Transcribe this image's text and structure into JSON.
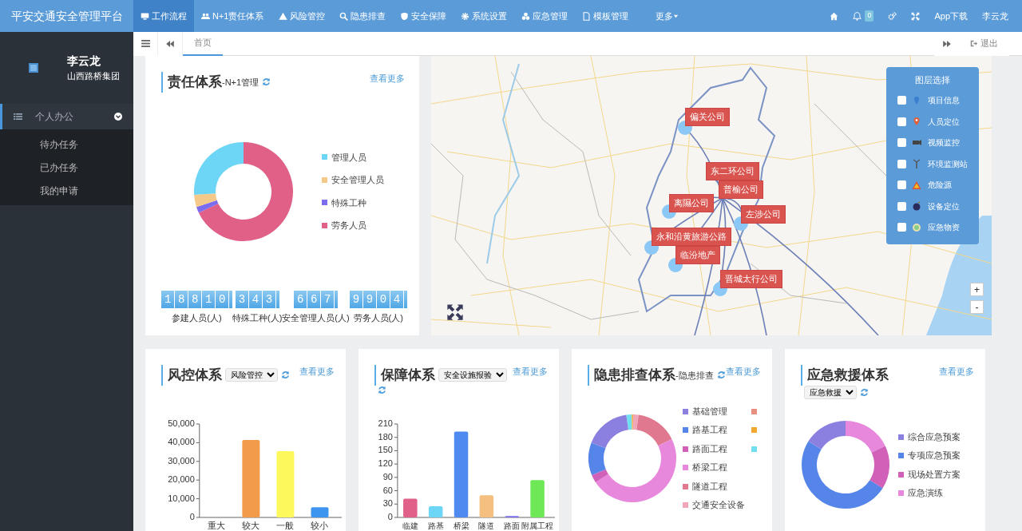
{
  "navbar": {
    "brand": "平安交通安全管理平台",
    "items": [
      {
        "label": "工作流程",
        "selected": true
      },
      {
        "label": "N+1责任体系",
        "selected": false
      },
      {
        "label": "风险管控",
        "selected": false
      },
      {
        "label": "隐患排查",
        "selected": false
      },
      {
        "label": "安全保障",
        "selected": false
      },
      {
        "label": "系统设置",
        "selected": false
      },
      {
        "label": "应急管理",
        "selected": false
      },
      {
        "label": "模板管理",
        "selected": false
      }
    ],
    "more": "更多",
    "notification_count": "0",
    "app_download": "App下载",
    "user": "李云龙"
  },
  "sidebar": {
    "user_name": "李云龙",
    "organization": "山西路桥集团",
    "menu": [
      {
        "label": "个人办公",
        "expanded": true,
        "children": [
          {
            "label": "待办任务"
          },
          {
            "label": "已办任务"
          },
          {
            "label": "我的申请"
          }
        ]
      }
    ]
  },
  "tabbar": {
    "tabs": [
      {
        "label": "首页",
        "selected": true
      }
    ],
    "logout": "退出"
  },
  "responsibility_panel": {
    "title": "责任体系",
    "subtitle": "-N+1管理",
    "more_link": "查看更多",
    "legend": [
      {
        "label": "管理人员",
        "color": "#6dd5f5"
      },
      {
        "label": "安全管理人员",
        "color": "#f5c98a"
      },
      {
        "label": "特殊工种",
        "color": "#7b6cf0"
      },
      {
        "label": "劳务人员",
        "color": "#e06087"
      }
    ],
    "counters": [
      {
        "value": "18810",
        "label": "参建人员(人)"
      },
      {
        "value": "343",
        "label": "特殊工种(人)"
      },
      {
        "value": "667",
        "label": "安全管理人员(人)"
      },
      {
        "value": "9904",
        "label": "劳务人员(人)"
      }
    ]
  },
  "map": {
    "markers": [
      {
        "label": "偏关公司"
      },
      {
        "label": "东二环公司"
      },
      {
        "label": "普榆公司"
      },
      {
        "label": "离隰公司"
      },
      {
        "label": "左涉公司"
      },
      {
        "label": "永和沿黄旅游公路"
      },
      {
        "label": "临汾地产"
      },
      {
        "label": "晋城太行公司"
      }
    ],
    "layer_panel": {
      "title": "图层选择",
      "layers": [
        {
          "label": "项目信息",
          "checked": false
        },
        {
          "label": "人员定位",
          "checked": false
        },
        {
          "label": "视频监控",
          "checked": false
        },
        {
          "label": "环境监测站",
          "checked": false
        },
        {
          "label": "危险源",
          "checked": false
        },
        {
          "label": "设备定位",
          "checked": false
        },
        {
          "label": "应急物资",
          "checked": false
        }
      ]
    },
    "zoom_in": "+",
    "zoom_out": "-"
  },
  "bottom_panels": [
    {
      "kind": "bar",
      "title": "风控体系",
      "select": "风险管控",
      "more_link": "查看更多",
      "chart_data": {
        "type": "bar",
        "categories": [
          "重大",
          "较大",
          "一般",
          "较小"
        ],
        "values": [
          0,
          41500,
          35500,
          5500
        ],
        "ylim": [
          0,
          50000
        ],
        "yticks": [
          {
            "value": 0,
            "label": "0"
          },
          {
            "value": 10000,
            "label": "10,000"
          },
          {
            "value": 20000,
            "label": "20,000"
          },
          {
            "value": 30000,
            "label": "30,000"
          },
          {
            "value": 40000,
            "label": "40,000"
          },
          {
            "value": 50000,
            "label": "50,000"
          }
        ]
      }
    },
    {
      "kind": "bar",
      "title": "保障体系",
      "select": "安全设施报验",
      "more_link": "查看更多",
      "chart_data": {
        "type": "bar",
        "categories": [
          "临建",
          "路基",
          "桥梁",
          "隧道",
          "路面",
          "附属工程"
        ],
        "values": [
          42,
          25,
          193,
          50,
          3,
          84
        ],
        "ylim": [
          0,
          210
        ],
        "yticks": [
          0,
          30,
          60,
          90,
          120,
          150,
          180,
          210
        ]
      }
    },
    {
      "kind": "donut",
      "title": "隐患排查体系",
      "subtitle": "-隐患排查",
      "more_link": "查看更多",
      "legend": [
        {
          "label": "基础管理",
          "color": "#8b80e0"
        },
        {
          "label": "路基工程",
          "color": "#5585e8"
        },
        {
          "label": "路面工程",
          "color": "#d060b8"
        },
        {
          "label": "桥梁工程",
          "color": "#e888dc"
        },
        {
          "label": "隧道工程",
          "color": "#e07890"
        },
        {
          "label": "交通安全设备",
          "color": "#f0a8b8"
        },
        {
          "color": "#e89080"
        },
        {
          "color": "#f0a830"
        },
        {
          "color": "#70e0f0"
        }
      ]
    },
    {
      "kind": "donut",
      "title": "应急救援体系",
      "select": "应急救援",
      "more_link": "查看更多",
      "legend": [
        {
          "label": "综合应急预案",
          "color": "#8b80e0"
        },
        {
          "label": "专项应急预案",
          "color": "#5585e8"
        },
        {
          "label": "现场处置方案",
          "color": "#d060b8"
        },
        {
          "label": "应急演练",
          "color": "#e888dc"
        }
      ]
    }
  ]
}
